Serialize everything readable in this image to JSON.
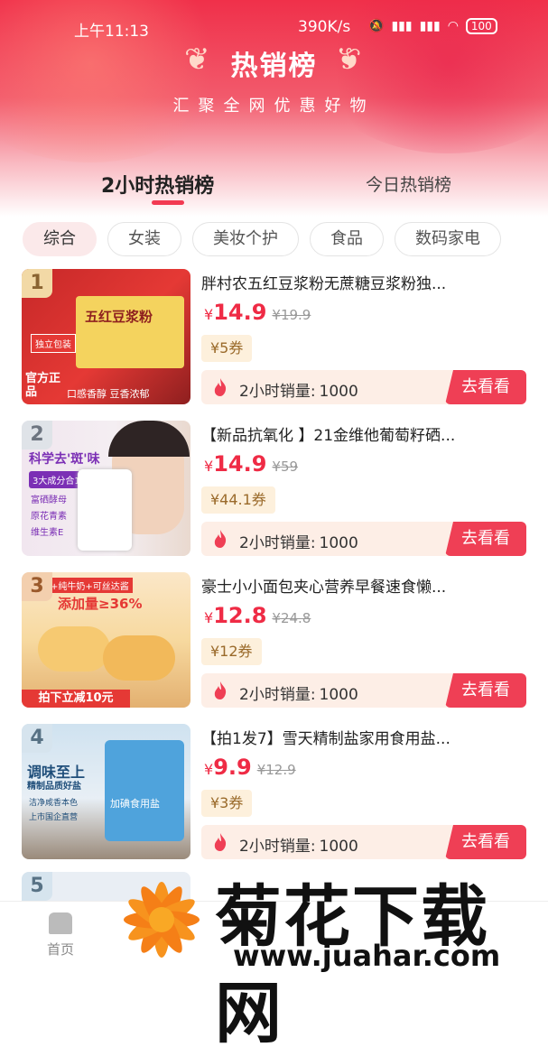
{
  "status": {
    "time": "上午11:13",
    "speed": "390K/s",
    "battery": "100"
  },
  "header": {
    "title": "热销榜",
    "subtitle": "汇聚全网优惠好物"
  },
  "tabs": [
    "2小时热销榜",
    "今日热销榜"
  ],
  "categories": [
    "综合",
    "女装",
    "美妆个护",
    "食品",
    "数码家电"
  ],
  "products": [
    {
      "rank": "1",
      "name": "胖村农五红豆浆粉无蔗糖豆浆粉独...",
      "yen": "¥",
      "price": "14.9",
      "original": "¥19.9",
      "coupon": "¥5券",
      "sales_label": "2小时销量:",
      "sales": "1000",
      "button": "去看看"
    },
    {
      "rank": "2",
      "name": "【新品抗氧化 】21金维他葡萄籽硒...",
      "yen": "¥",
      "price": "14.9",
      "original": "¥59",
      "coupon": "¥44.1券",
      "sales_label": "2小时销量:",
      "sales": "1000",
      "button": "去看看"
    },
    {
      "rank": "3",
      "name": "豪士小小面包夹心营养早餐速食懒...",
      "yen": "¥",
      "price": "12.8",
      "original": "¥24.8",
      "coupon": "¥12券",
      "sales_label": "2小时销量:",
      "sales": "1000",
      "button": "去看看"
    },
    {
      "rank": "4",
      "name": "【拍1发7】雪天精制盐家用食用盐...",
      "yen": "¥",
      "price": "9.9",
      "original": "¥12.9",
      "coupon": "¥3券",
      "sales_label": "2小时销量:",
      "sales": "1000",
      "button": "去看看"
    }
  ],
  "thumbs": [
    {
      "top": "五红豆浆粉",
      "badge": "独立包装",
      "side": "官方正品",
      "bottom": "口感香醇 豆香浓郁"
    },
    {
      "top": "科学去'斑'味",
      "sub": "3大成分合1",
      "items": [
        "富硒酵母",
        "原花青素",
        "维生素E"
      ]
    },
    {
      "top": "鸡蛋+纯牛奶+可丝达酱",
      "sub": "添加量≥36%",
      "bottom": "拍下立减10元"
    },
    {
      "top": "调味至上",
      "sub": "精制品质好盐",
      "bag": "加碘食用盐",
      "items": [
        "洁净咸香本色",
        "上市国企直营"
      ]
    }
  ],
  "peek_rank": "5",
  "bottom_nav": {
    "home": "首页"
  },
  "watermark": {
    "text": "菊花下载网",
    "url": "www.juahar.com"
  }
}
